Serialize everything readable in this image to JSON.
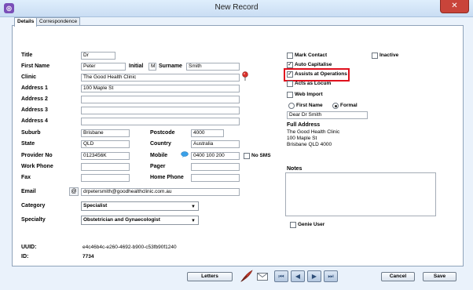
{
  "window": {
    "title": "New Record",
    "app_icon": "app-logo-icon",
    "close_label": "✕"
  },
  "tabs": [
    {
      "label": "Details",
      "active": true
    },
    {
      "label": "Correspondence",
      "active": false
    }
  ],
  "form": {
    "title": {
      "label": "Title",
      "value": "Dr"
    },
    "first_name": {
      "label": "First Name",
      "value": "Peter"
    },
    "initial": {
      "label": "Initial",
      "value": "M"
    },
    "surname": {
      "label": "Surname",
      "value": "Smith"
    },
    "clinic": {
      "label": "Clinic",
      "value": "The Good Health Clinic"
    },
    "address1": {
      "label": "Address 1",
      "value": "100 Maple St"
    },
    "address2": {
      "label": "Address 2",
      "value": ""
    },
    "address3": {
      "label": "Address 3",
      "value": ""
    },
    "address4": {
      "label": "Address 4",
      "value": ""
    },
    "suburb": {
      "label": "Suburb",
      "value": "Brisbane"
    },
    "postcode": {
      "label": "Postcode",
      "value": "4000"
    },
    "state": {
      "label": "State",
      "value": "QLD"
    },
    "country": {
      "label": "Country",
      "value": "Australia"
    },
    "provider_no": {
      "label": "Provider No",
      "value": "0123456K"
    },
    "mobile": {
      "label": "Mobile",
      "value": "0400 100 200"
    },
    "no_sms": {
      "label": "No SMS",
      "checked": false
    },
    "work_phone": {
      "label": "Work Phone",
      "value": ""
    },
    "pager": {
      "label": "Pager",
      "value": ""
    },
    "fax": {
      "label": "Fax",
      "value": ""
    },
    "home_phone": {
      "label": "Home Phone",
      "value": ""
    },
    "email": {
      "label": "Email",
      "value": "drpetersmith@goodhealthclinic.com.au"
    },
    "category": {
      "label": "Category",
      "value": "Specialist"
    },
    "specialty": {
      "label": "Specialty",
      "value": "Obstetrician and Gynaecologist"
    },
    "uuid": {
      "label": "UUID:",
      "value": "e4c46b4c-e260-4692-b900-c53fb90f1240"
    },
    "id": {
      "label": "ID:",
      "value": "7734"
    }
  },
  "options": {
    "mark_contact": {
      "label": "Mark Contact",
      "checked": false
    },
    "inactive": {
      "label": "Inactive",
      "checked": false
    },
    "auto_capitalise": {
      "label": "Auto Capitalise",
      "checked": true
    },
    "assists_at_operations": {
      "label": "Assists at Operations",
      "checked": true
    },
    "acts_as_locum": {
      "label": "Acts as Locum",
      "checked": false
    },
    "web_import": {
      "label": "Web Import",
      "checked": false
    },
    "salutation_first_name": {
      "label": "First Name",
      "selected": false
    },
    "salutation_formal": {
      "label": "Formal",
      "selected": true
    },
    "salutation_value": "Dear Dr Smith",
    "full_address_label": "Full Address",
    "full_address_lines": [
      "The Good Health Clinic",
      "100 Maple St",
      "Brisbane QLD 4000"
    ],
    "notes_label": "Notes",
    "notes_value": "",
    "genie_user": {
      "label": "Genie User",
      "checked": false
    }
  },
  "footer": {
    "letters_label": "Letters",
    "cancel_label": "Cancel",
    "save_label": "Save"
  },
  "colors": {
    "highlight": "#e0101d",
    "accent": "#7a4fb8"
  }
}
